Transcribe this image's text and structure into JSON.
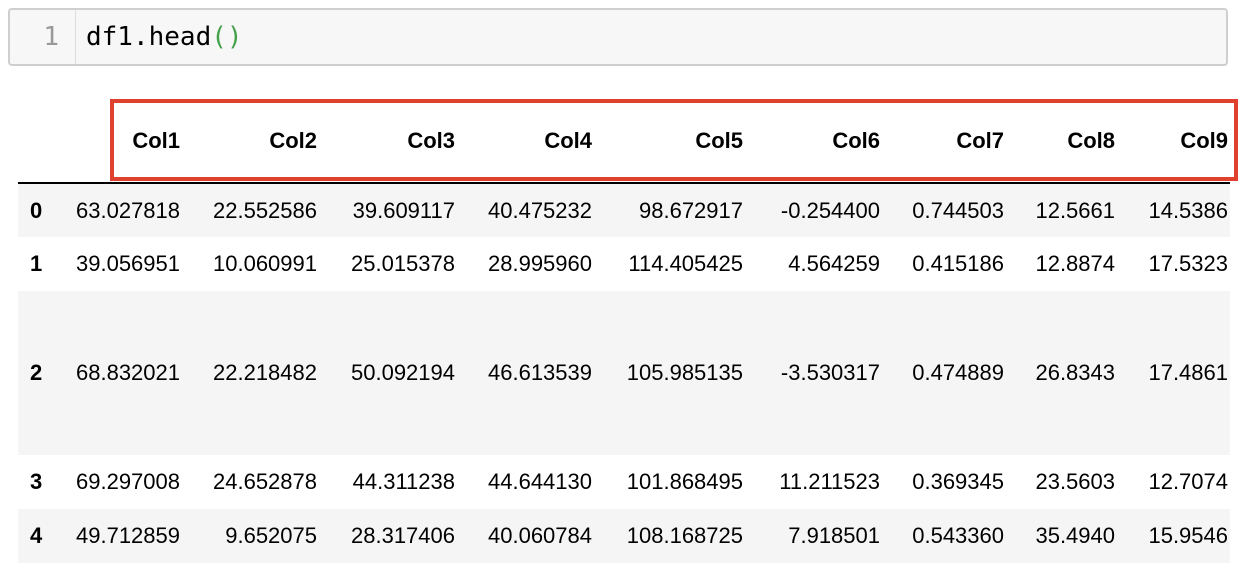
{
  "cell": {
    "line_number": "1",
    "code_text": "df1.head",
    "code_parens": "()"
  },
  "dataframe": {
    "columns": [
      "Col1",
      "Col2",
      "Col3",
      "Col4",
      "Col5",
      "Col6",
      "Col7",
      "Col8",
      "Col9"
    ],
    "rows": [
      {
        "index": "0",
        "values": [
          "63.027818",
          "22.552586",
          "39.609117",
          "40.475232",
          "98.672917",
          "-0.254400",
          "0.744503",
          "12.5661",
          "14.5386"
        ]
      },
      {
        "index": "1",
        "values": [
          "39.056951",
          "10.060991",
          "25.015378",
          "28.995960",
          "114.405425",
          "4.564259",
          "0.415186",
          "12.8874",
          "17.5323"
        ]
      },
      {
        "index": "2",
        "values": [
          "68.832021",
          "22.218482",
          "50.092194",
          "46.613539",
          "105.985135",
          "-3.530317",
          "0.474889",
          "26.8343",
          "17.4861"
        ]
      },
      {
        "index": "3",
        "values": [
          "69.297008",
          "24.652878",
          "44.311238",
          "44.644130",
          "101.868495",
          "11.211523",
          "0.369345",
          "23.5603",
          "12.7074"
        ]
      },
      {
        "index": "4",
        "values": [
          "49.712859",
          "9.652075",
          "28.317406",
          "40.060784",
          "108.168725",
          "7.918501",
          "0.543360",
          "35.4940",
          "15.9546"
        ]
      }
    ]
  },
  "colors": {
    "highlight_box": "#e0412e",
    "code_paren": "#44a04a",
    "striped_row": "#f5f5f5"
  }
}
